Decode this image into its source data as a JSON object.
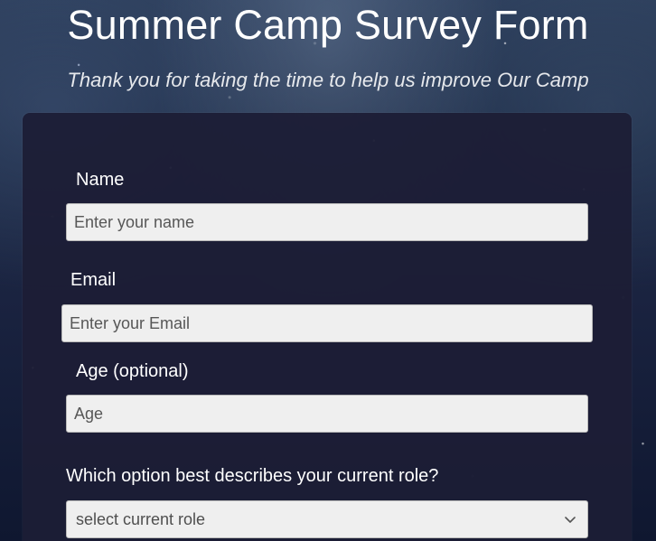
{
  "header": {
    "title": "Summer Camp Survey Form",
    "subtitle": "Thank you for taking the time to help us improve Our Camp"
  },
  "form": {
    "name": {
      "label": "Name",
      "placeholder": "Enter your name",
      "value": ""
    },
    "email": {
      "label": "Email",
      "placeholder": "Enter your Email",
      "value": ""
    },
    "age": {
      "label": "Age (optional)",
      "placeholder": "Age",
      "value": ""
    },
    "role": {
      "label": "Which option best describes your current role?",
      "selected": "select current role",
      "icon": "chevron-down-icon"
    }
  }
}
